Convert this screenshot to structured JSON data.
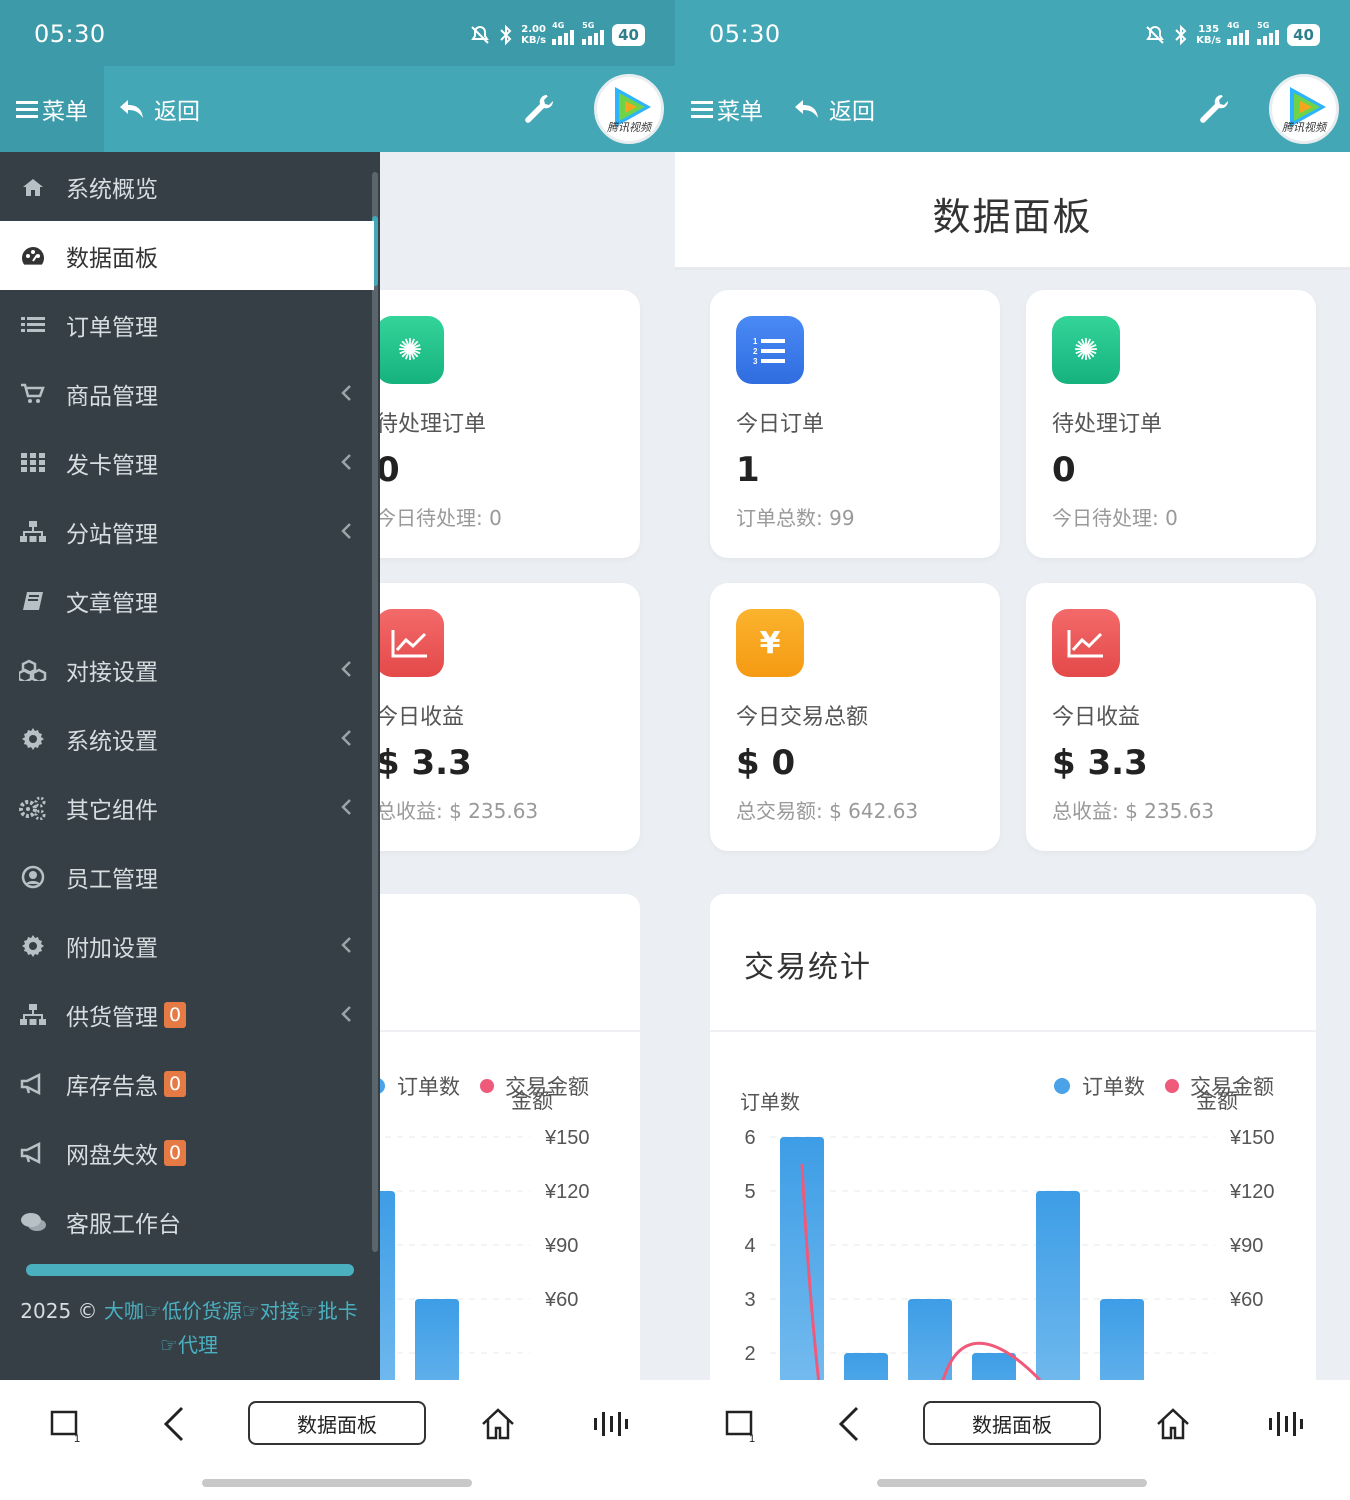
{
  "status": {
    "time": "05:30",
    "speed_left": [
      "2.00",
      "KB/s"
    ],
    "speed_right": [
      "135",
      "KB/s"
    ],
    "net1": "4G",
    "net2": "5G",
    "battery": "40"
  },
  "nav": {
    "menu_label": "菜单",
    "back_label": "返回",
    "logo_text": "腾讯视频"
  },
  "page": {
    "title": "数据面板"
  },
  "cards": [
    {
      "label": "待处理订单",
      "value": "0",
      "sub": "今日待处理: 0",
      "icon": "gear-box-icon",
      "color": "#1fbf88"
    },
    {
      "label": "今日订单",
      "value": "1",
      "sub": "订单总数: 99",
      "icon": "ordered-list-icon",
      "color": "#3b7be9"
    },
    {
      "label": "待处理订单",
      "value": "0",
      "sub": "今日待处理: 0",
      "icon": "gear-box-icon",
      "color": "#1fbf88"
    },
    {
      "label": "今日收益",
      "value": "$ 3.3",
      "sub": "总收益: $ 235.63",
      "icon": "line-chart-icon",
      "color": "#ea5555"
    },
    {
      "label": "今日交易总额",
      "value": "$ 0",
      "sub": "总交易额: $ 642.63",
      "icon": "yen-icon",
      "color": "#f7a21c"
    },
    {
      "label": "今日收益",
      "value": "$ 3.3",
      "sub": "总收益: $ 235.63",
      "icon": "line-chart-icon",
      "color": "#ea5555"
    }
  ],
  "sidebar": {
    "items": [
      {
        "label": "系统概览",
        "icon": "home-icon",
        "chevron": false,
        "badge": null
      },
      {
        "label": "数据面板",
        "icon": "dashboard-icon",
        "chevron": false,
        "badge": null,
        "active": true
      },
      {
        "label": "订单管理",
        "icon": "list-icon",
        "chevron": false,
        "badge": null
      },
      {
        "label": "商品管理",
        "icon": "cart-icon",
        "chevron": true,
        "badge": null
      },
      {
        "label": "发卡管理",
        "icon": "grid-icon",
        "chevron": true,
        "badge": null
      },
      {
        "label": "分站管理",
        "icon": "sitemap-icon",
        "chevron": true,
        "badge": null
      },
      {
        "label": "文章管理",
        "icon": "book-icon",
        "chevron": false,
        "badge": null
      },
      {
        "label": "对接设置",
        "icon": "cubes-icon",
        "chevron": true,
        "badge": null
      },
      {
        "label": "系统设置",
        "icon": "gear-icon",
        "chevron": true,
        "badge": null
      },
      {
        "label": "其它组件",
        "icon": "gears-icon",
        "chevron": true,
        "badge": null
      },
      {
        "label": "员工管理",
        "icon": "user-circle-icon",
        "chevron": false,
        "badge": null
      },
      {
        "label": "附加设置",
        "icon": "gear-icon",
        "chevron": true,
        "badge": null
      },
      {
        "label": "供货管理",
        "icon": "sitemap-icon",
        "chevron": true,
        "badge": "0"
      },
      {
        "label": "库存告急",
        "icon": "bullhorn-icon",
        "chevron": false,
        "badge": "0"
      },
      {
        "label": "网盘失效",
        "icon": "bullhorn-icon",
        "chevron": false,
        "badge": "0"
      },
      {
        "label": "客服工作台",
        "icon": "chat-icon",
        "chevron": false,
        "badge": null
      }
    ],
    "footer_prefix": "2025 © ",
    "footer_link": "大咖☞低价货源☞对接☞批卡☞代理"
  },
  "bottom_nav": {
    "title": "数据面板",
    "recent_count": "1"
  },
  "chart_data": {
    "type": "bar",
    "title": "交易统计",
    "series": [
      {
        "name": "订单数",
        "type": "bar",
        "axis": "left",
        "color": "#4aa3e8",
        "values": [
          6,
          2,
          3,
          2,
          5,
          3
        ]
      },
      {
        "name": "交易金额",
        "type": "line",
        "axis": "right",
        "color": "#f05a7a",
        "values": [
          165,
          0,
          0,
          0,
          0,
          0
        ]
      }
    ],
    "legend": [
      "订单数",
      "交易金额"
    ],
    "legend_extra": "金额",
    "ylabel_left": "订单数",
    "yticks_left": [
      "6",
      "5",
      "4",
      "3",
      "2"
    ],
    "yticks_right": [
      "¥150",
      "¥120",
      "¥90",
      "¥60"
    ],
    "ylim_left": [
      0,
      6
    ],
    "ylim_right": [
      0,
      180
    ],
    "legend_position": "top-right",
    "grid": true
  }
}
